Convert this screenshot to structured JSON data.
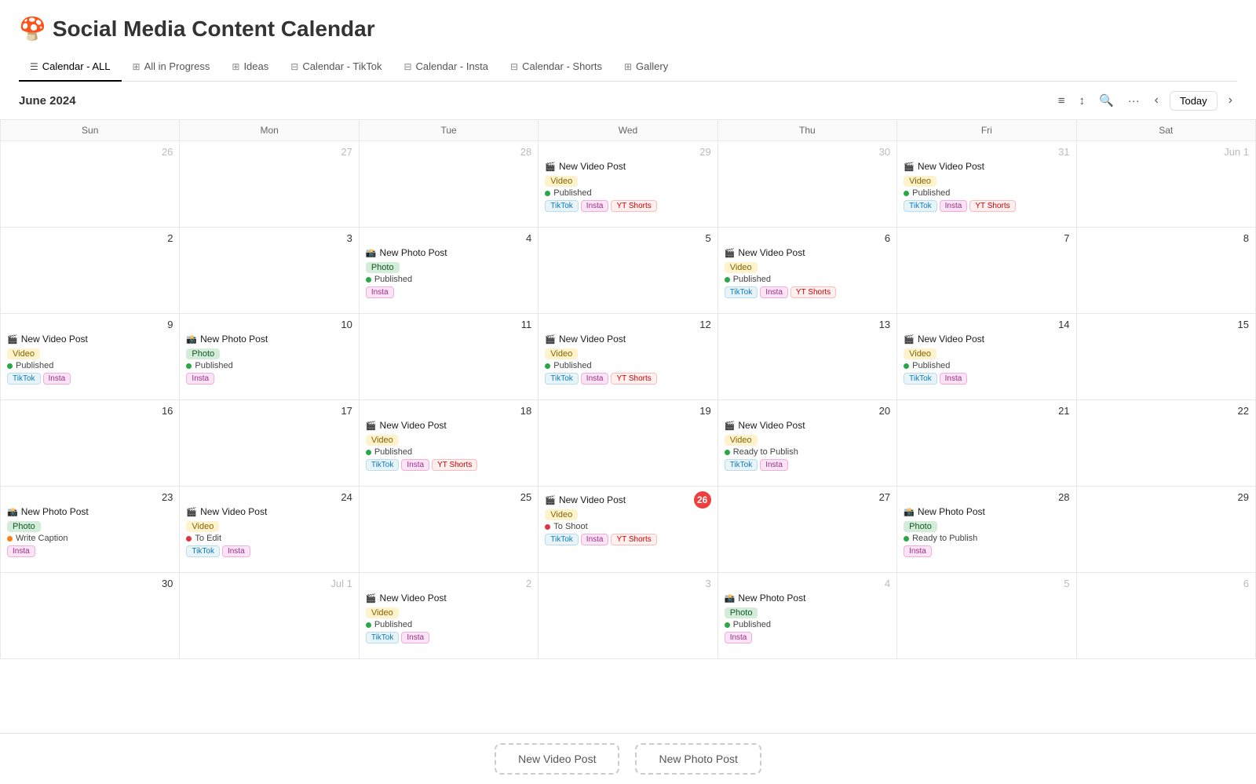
{
  "title": {
    "emoji": "🍄",
    "text": "Social Media Content Calendar"
  },
  "tabs": [
    {
      "id": "calendar-all",
      "icon": "☰",
      "label": "Calendar - ALL",
      "active": true
    },
    {
      "id": "all-in-progress",
      "icon": "⊞",
      "label": "All in Progress",
      "active": false
    },
    {
      "id": "ideas",
      "icon": "⊞",
      "label": "Ideas",
      "active": false
    },
    {
      "id": "calendar-tiktok",
      "icon": "⊟",
      "label": "Calendar - TikTok",
      "active": false
    },
    {
      "id": "calendar-insta",
      "icon": "⊟",
      "label": "Calendar - Insta",
      "active": false
    },
    {
      "id": "calendar-shorts",
      "icon": "⊟",
      "label": "Calendar - Shorts",
      "active": false
    },
    {
      "id": "gallery",
      "icon": "⊞",
      "label": "Gallery",
      "active": false
    }
  ],
  "month_label": "June 2024",
  "today_label": "Today",
  "weekdays": [
    "Sun",
    "Mon",
    "Tue",
    "Wed",
    "Thu",
    "Fri",
    "Sat"
  ],
  "rows": [
    {
      "cells": [
        {
          "date": "26",
          "otherMonth": true,
          "events": []
        },
        {
          "date": "27",
          "otherMonth": true,
          "events": []
        },
        {
          "date": "28",
          "otherMonth": true,
          "events": []
        },
        {
          "date": "29",
          "otherMonth": true,
          "events": [
            {
              "title": "New Video Post",
              "emoji": "🎬",
              "type": "video",
              "status": "published",
              "status_label": "Published",
              "platforms": [
                "TikTok",
                "Insta",
                "YT Shorts"
              ]
            }
          ]
        },
        {
          "date": "30",
          "otherMonth": true,
          "events": []
        },
        {
          "date": "31",
          "otherMonth": true,
          "events": [
            {
              "title": "New Video Post",
              "emoji": "🎬",
              "type": "video",
              "status": "published",
              "status_label": "Published",
              "platforms": [
                "TikTok",
                "Insta",
                "YT Shorts"
              ]
            }
          ]
        },
        {
          "date": "Jun 1",
          "otherMonth": true,
          "events": []
        }
      ]
    },
    {
      "cells": [
        {
          "date": "2",
          "events": []
        },
        {
          "date": "3",
          "events": []
        },
        {
          "date": "4",
          "events": [
            {
              "title": "New Photo Post",
              "emoji": "📸",
              "type": "photo",
              "status": "published",
              "status_label": "Published",
              "platforms": [
                "Insta"
              ]
            }
          ]
        },
        {
          "date": "5",
          "events": []
        },
        {
          "date": "6",
          "events": [
            {
              "title": "New Video Post",
              "emoji": "🎬",
              "type": "video",
              "status": "published",
              "status_label": "Published",
              "platforms": [
                "TikTok",
                "Insta",
                "YT Shorts"
              ]
            }
          ]
        },
        {
          "date": "7",
          "events": []
        },
        {
          "date": "8",
          "events": []
        }
      ]
    },
    {
      "cells": [
        {
          "date": "9",
          "events": [
            {
              "title": "New Video Post",
              "emoji": "🎬",
              "type": "video",
              "status": "published",
              "status_label": "Published",
              "platforms": [
                "TikTok",
                "Insta"
              ]
            }
          ]
        },
        {
          "date": "10",
          "events": [
            {
              "title": "New Photo Post",
              "emoji": "📸",
              "type": "photo",
              "status": "published",
              "status_label": "Published",
              "platforms": [
                "Insta"
              ]
            }
          ]
        },
        {
          "date": "11",
          "events": []
        },
        {
          "date": "12",
          "events": [
            {
              "title": "New Video Post",
              "emoji": "🎬",
              "type": "video",
              "status": "published",
              "status_label": "Published",
              "platforms": [
                "TikTok",
                "Insta",
                "YT Shorts"
              ]
            }
          ]
        },
        {
          "date": "13",
          "events": []
        },
        {
          "date": "14",
          "events": [
            {
              "title": "New Video Post",
              "emoji": "🎬",
              "type": "video",
              "status": "published",
              "status_label": "Published",
              "platforms": [
                "TikTok",
                "Insta"
              ]
            }
          ]
        },
        {
          "date": "15",
          "events": []
        }
      ]
    },
    {
      "cells": [
        {
          "date": "16",
          "events": []
        },
        {
          "date": "17",
          "events": []
        },
        {
          "date": "18",
          "events": [
            {
              "title": "New Video Post",
              "emoji": "🎬",
              "type": "video",
              "status": "published",
              "status_label": "Published",
              "platforms": [
                "TikTok",
                "Insta",
                "YT Shorts"
              ]
            }
          ]
        },
        {
          "date": "19",
          "events": []
        },
        {
          "date": "20",
          "events": [
            {
              "title": "New Video Post",
              "emoji": "🎬",
              "type": "video",
              "status": "ready",
              "status_label": "Ready to Publish",
              "platforms": [
                "TikTok",
                "Insta"
              ]
            }
          ]
        },
        {
          "date": "21",
          "events": []
        },
        {
          "date": "22",
          "events": []
        }
      ]
    },
    {
      "cells": [
        {
          "date": "23",
          "events": [
            {
              "title": "New Photo Post",
              "emoji": "📸",
              "type": "photo",
              "status": "write",
              "status_label": "Write Caption",
              "platforms": [
                "Insta"
              ]
            }
          ]
        },
        {
          "date": "24",
          "events": [
            {
              "title": "New Video Post",
              "emoji": "🎬",
              "type": "video",
              "status": "toedit",
              "status_label": "To Edit",
              "platforms": [
                "TikTok",
                "Insta"
              ]
            }
          ]
        },
        {
          "date": "25",
          "events": []
        },
        {
          "date": "26",
          "today": true,
          "events": [
            {
              "title": "New Video Post",
              "emoji": "🎬",
              "type": "video",
              "status": "toshoot",
              "status_label": "To Shoot",
              "platforms": [
                "TikTok",
                "Insta",
                "YT Shorts"
              ]
            }
          ]
        },
        {
          "date": "27",
          "events": []
        },
        {
          "date": "28",
          "events": [
            {
              "title": "New Photo Post",
              "emoji": "📸",
              "type": "photo",
              "status": "ready",
              "status_label": "Ready to Publish",
              "platforms": [
                "Insta"
              ]
            }
          ]
        },
        {
          "date": "29",
          "events": []
        }
      ]
    },
    {
      "cells": [
        {
          "date": "30",
          "events": []
        },
        {
          "date": "Jul 1",
          "otherMonth": true,
          "events": []
        },
        {
          "date": "2",
          "otherMonth": true,
          "events": [
            {
              "title": "New Video Post",
              "emoji": "🎬",
              "type": "video",
              "status": "published",
              "status_label": "Published",
              "platforms": [
                "TikTok",
                "Insta"
              ]
            }
          ]
        },
        {
          "date": "3",
          "otherMonth": true,
          "events": []
        },
        {
          "date": "4",
          "otherMonth": true,
          "events": [
            {
              "title": "New Photo Post",
              "emoji": "📸",
              "type": "photo",
              "status": "published",
              "status_label": "Published",
              "platforms": [
                "Insta"
              ]
            }
          ]
        },
        {
          "date": "5",
          "otherMonth": true,
          "events": []
        },
        {
          "date": "6",
          "otherMonth": true,
          "events": []
        }
      ]
    }
  ],
  "bottom_buttons": [
    {
      "id": "new-video-post",
      "label": "New Video Post"
    },
    {
      "id": "new-photo-post",
      "label": "New Photo Post"
    }
  ]
}
